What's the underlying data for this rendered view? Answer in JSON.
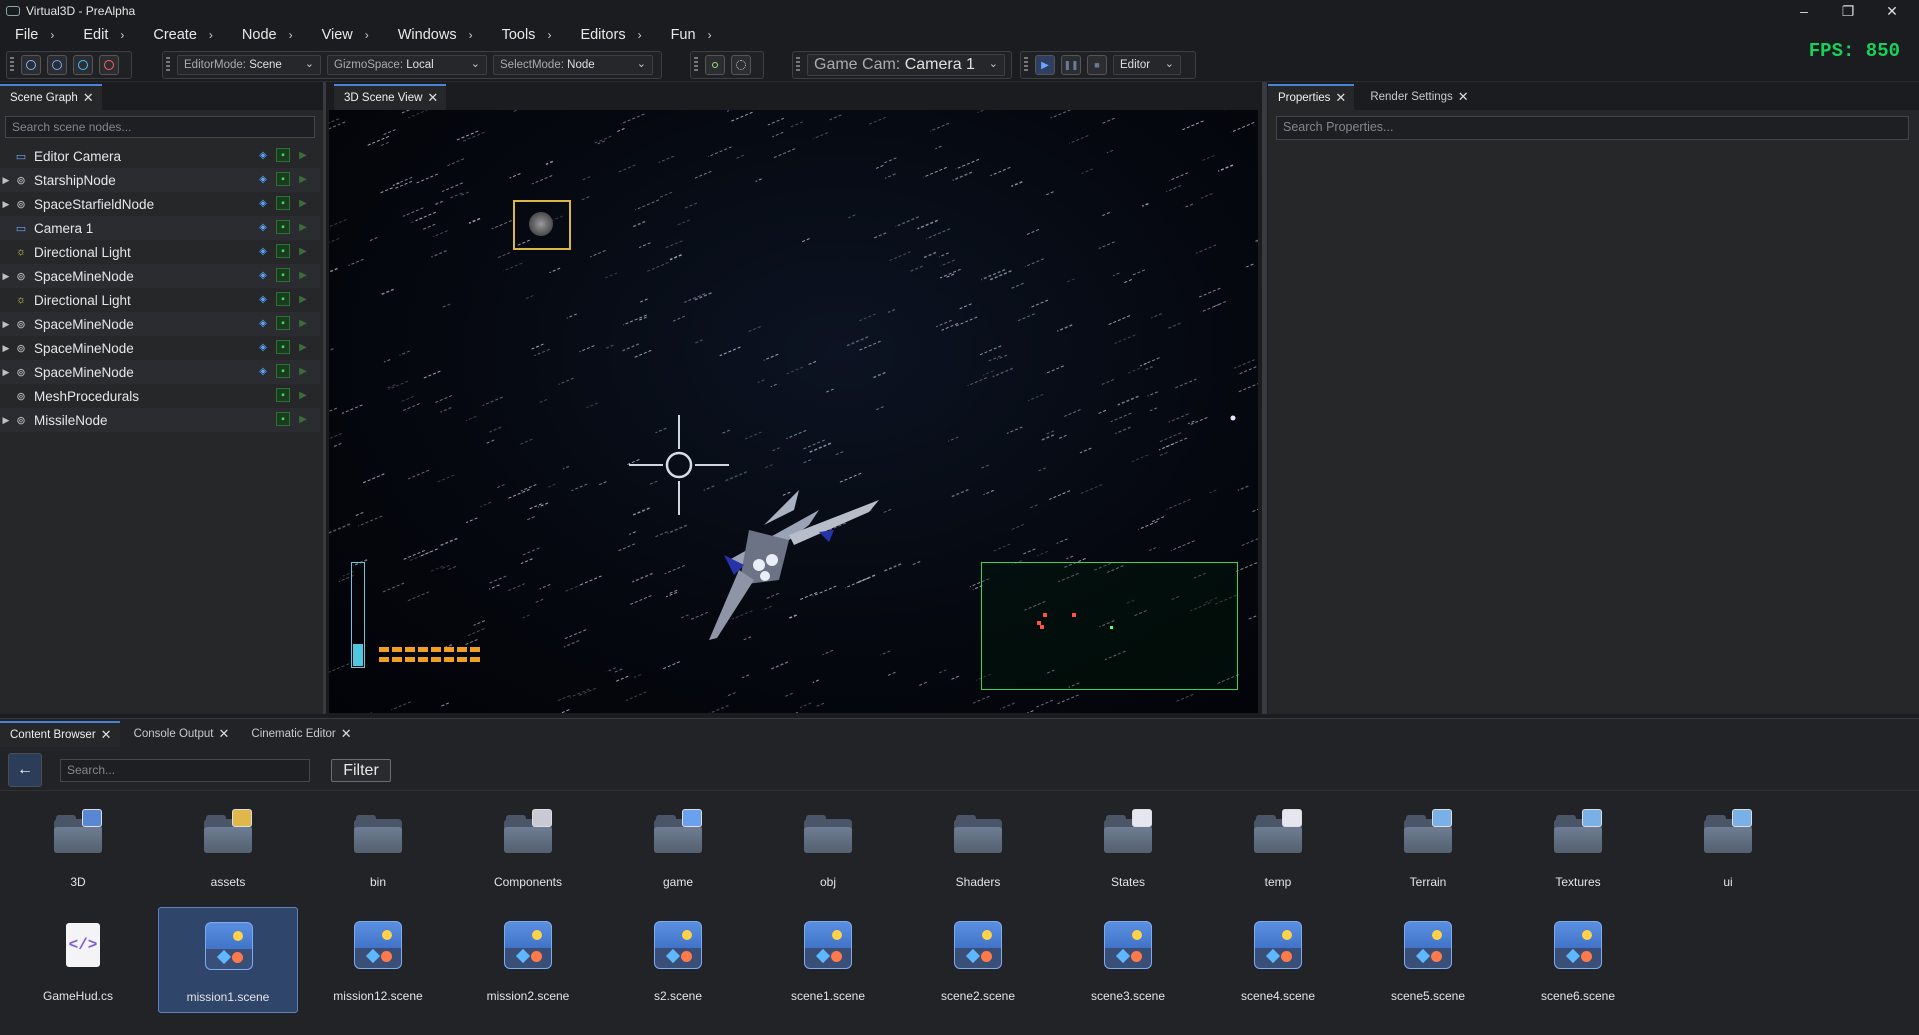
{
  "window": {
    "title": "Virtual3D - PreAlpha",
    "min": "–",
    "max": "❐",
    "close": "✕"
  },
  "menu": [
    {
      "label": "File",
      "chev": "›"
    },
    {
      "label": "Edit",
      "chev": "›"
    },
    {
      "label": "Create",
      "chev": "›"
    },
    {
      "label": "Node",
      "chev": "›"
    },
    {
      "label": "View",
      "chev": "›"
    },
    {
      "label": "Windows",
      "chev": "›"
    },
    {
      "label": "Tools",
      "chev": "›"
    },
    {
      "label": "Editors",
      "chev": "›"
    },
    {
      "label": "Fun",
      "chev": "›"
    }
  ],
  "toolbar": {
    "editor_mode_key": "EditorMode:",
    "editor_mode_val": "Scene",
    "gizmo_key": "GizmoSpace:",
    "gizmo_val": "Local",
    "select_key": "SelectMode:",
    "select_val": "Node",
    "game_cam_key": "Game Cam:",
    "game_cam_val": "Camera 1",
    "play_target": "Editor"
  },
  "fps": "FPS: 850",
  "scene_graph": {
    "tab": "Scene Graph",
    "search_placeholder": "Search scene nodes...",
    "nodes": [
      {
        "label": "Editor Camera",
        "kind": "camera"
      },
      {
        "label": "StarshipNode",
        "kind": "node"
      },
      {
        "label": "SpaceStarfieldNode",
        "kind": "node"
      },
      {
        "label": "Camera 1",
        "kind": "camera"
      },
      {
        "label": "Directional Light",
        "kind": "light"
      },
      {
        "label": "SpaceMineNode",
        "kind": "node"
      },
      {
        "label": "Directional Light",
        "kind": "light"
      },
      {
        "label": "SpaceMineNode",
        "kind": "node"
      },
      {
        "label": "SpaceMineNode",
        "kind": "node"
      },
      {
        "label": "SpaceMineNode",
        "kind": "node"
      },
      {
        "label": "MeshProcedurals",
        "kind": "node"
      },
      {
        "label": "MissileNode",
        "kind": "node"
      }
    ]
  },
  "viewport": {
    "tab": "3D Scene View"
  },
  "properties": {
    "tab": "Properties",
    "tab2": "Render Settings",
    "search_placeholder": "Search Properties..."
  },
  "bottom": {
    "tabs": [
      "Content Browser",
      "Console Output",
      "Cinematic Editor"
    ],
    "back_icon": "←",
    "search_placeholder": "Search...",
    "filter_label": "Filter",
    "folders": [
      "3D",
      "assets",
      "bin",
      "Components",
      "game",
      "obj",
      "Shaders",
      "States",
      "temp",
      "Terrain",
      "Textures",
      "ui"
    ],
    "files": [
      "GameHud.cs",
      "mission1.scene",
      "mission12.scene",
      "mission2.scene",
      "s2.scene",
      "scene1.scene",
      "scene2.scene",
      "scene3.scene",
      "scene4.scene",
      "scene5.scene",
      "scene6.scene"
    ],
    "selected_file": "mission1.scene"
  },
  "colors": {
    "accent": "#4a82d8",
    "fps": "#19d05a",
    "radar": "#3ad45a",
    "hud_bar": "#f0a020"
  }
}
